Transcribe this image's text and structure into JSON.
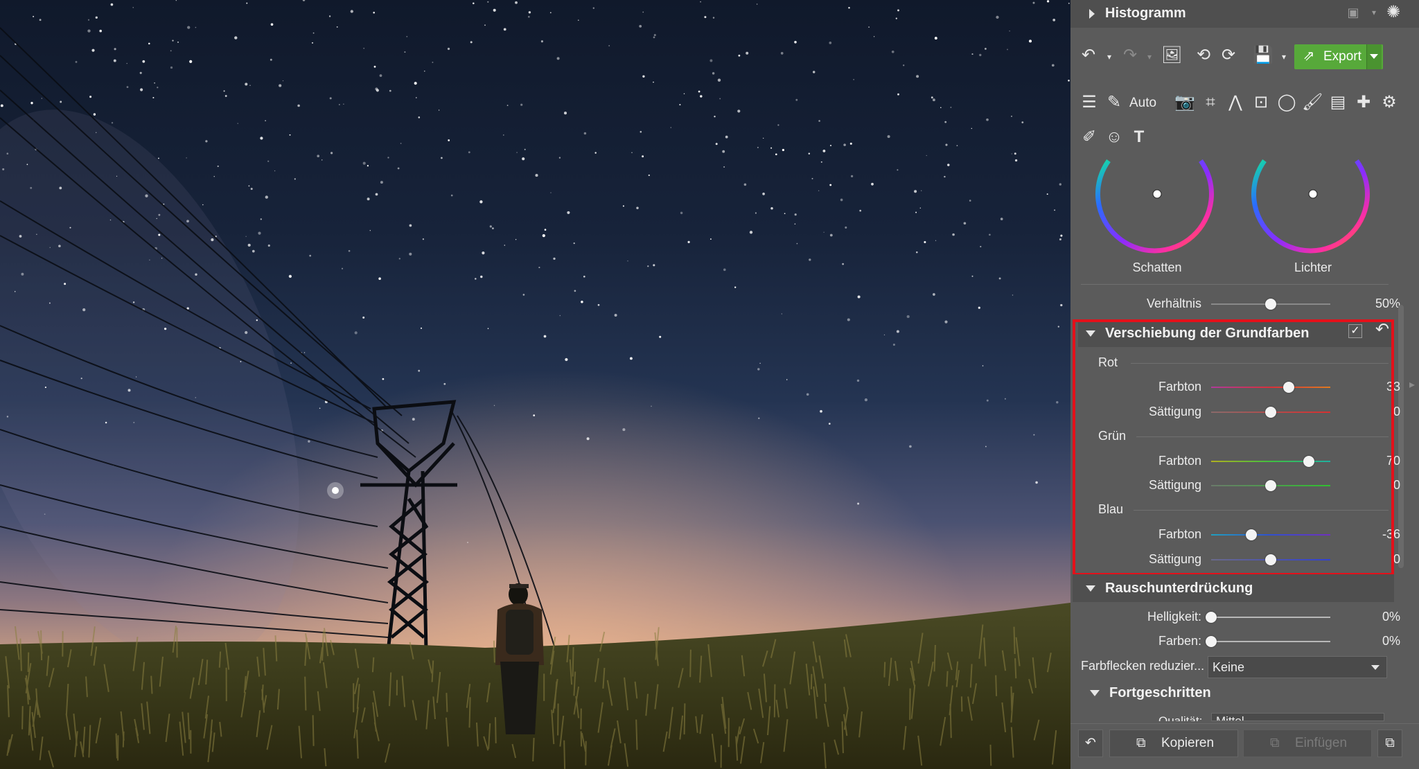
{
  "histogram": {
    "title": "Histogramm"
  },
  "toolbar": {
    "export_label": "Export",
    "auto_label": "Auto"
  },
  "color_wheels": {
    "shadows_label": "Schatten",
    "highlights_label": "Lichter"
  },
  "ratio": {
    "label": "Verhältnis",
    "value": "50%",
    "level": 0.5
  },
  "primary_shift": {
    "title": "Verschiebung der Grundfarben",
    "groups": [
      {
        "name": "Rot",
        "hue": {
          "label": "Farbton",
          "value": "33",
          "level": 0.65
        },
        "saturation": {
          "label": "Sättigung",
          "value": "0",
          "level": 0.5
        }
      },
      {
        "name": "Grün",
        "hue": {
          "label": "Farbton",
          "value": "70",
          "level": 0.82
        },
        "saturation": {
          "label": "Sättigung",
          "value": "0",
          "level": 0.5
        }
      },
      {
        "name": "Blau",
        "hue": {
          "label": "Farbton",
          "value": "-36",
          "level": 0.34
        },
        "saturation": {
          "label": "Sättigung",
          "value": "0",
          "level": 0.5
        }
      }
    ]
  },
  "noise": {
    "title": "Rauschunterdrückung",
    "brightness": {
      "label": "Helligkeit:",
      "value": "0%",
      "level": 0
    },
    "colors": {
      "label": "Farben:",
      "value": "0%",
      "level": 0
    },
    "blotch": {
      "label": "Farbflecken reduzier...",
      "value": "Keine"
    }
  },
  "advanced": {
    "title": "Fortgeschritten",
    "quality_label": "Qualität:",
    "quality_value": "Mittel"
  },
  "footer": {
    "copy_label": "Kopieren",
    "paste_label": "Einfügen"
  },
  "colors": {
    "accent_green": "#57a93a",
    "highlight_red": "#e4101a",
    "panel_bg": "#5b5b5b"
  }
}
